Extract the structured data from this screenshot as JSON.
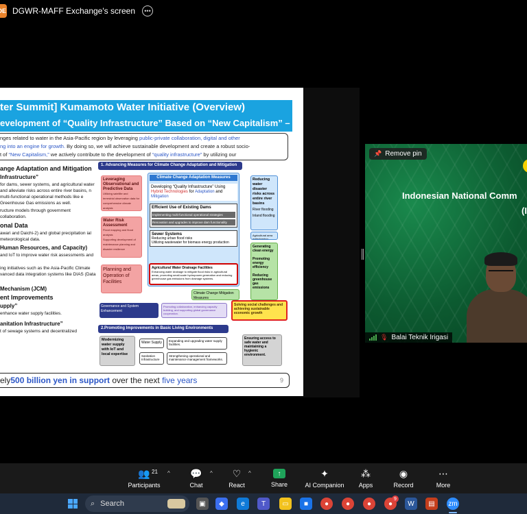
{
  "window": {
    "share_title": "DGWR-MAFF Exchange's screen",
    "badge": "DE"
  },
  "slide": {
    "title_line1": "ter Summit]   Kumamoto Water Initiative (Overview)",
    "title_line2": "evelopment of “Quality Infrastructure” Based on “New Capitalism” –",
    "intro_1": "nges related to water in the Asia-Pacific region by leveraging ",
    "intro_1_blue": "public-private collaboration, digital and other",
    "intro_2_blue": "ng into an engine for growth.",
    "intro_2": " By doing so, we will achieve sustainable development and create a robust socio-",
    "intro_3": "t of ",
    "intro_3_blue": "“New Capitalism,”",
    "intro_3b": " we actively contribute to the development of ",
    "intro_3_blue2": "“quality infrastructure”",
    "intro_3c": " by utilizing our",
    "left": {
      "h1": "ange Adaptation and Mitigation",
      "h2": "Infrastructure”",
      "p1": "for dams, sewer systems, and agricultural water and alleviate risks across entire river basins, n multi-functional operational methods like e Greenhouse Gas emissions as well.",
      "p2": "ructure models through government collaboration.",
      "h3": "onal Data",
      "p3": "awari and Daichi-2) and global precipitation ial meteorological data.",
      "h4": "Human Resources, and Capacity)",
      "p4": "and IoT to improve water risk assessments and",
      "p5": "ing initiatives such as the Asia-Pacific Climate vanced data integration systems like DIAS (Data",
      "h5": "Mechanism (JCM)",
      "h6": "ent Improvements",
      "h7": "upply”",
      "p6": "enhance water supply facilities.",
      "h8": "anitation Infrastructure”",
      "p7": "t of sewage systems and decentralized"
    },
    "diagram": {
      "band1": "1.   Advancing Measures for Climate Change Adaptation and Mitigation",
      "leveraging": "Leveraging Observational and Predictive Data",
      "leveraging_sub": "Utilizing satellite and terrestrial observation data for comprehensive climate analysis",
      "water_risk": "Water Risk Assessment",
      "water_risk_sub1": "Flood mapping and flood analysis",
      "water_risk_sub2": "Supporting development of maintenance planning and disaster resilience",
      "planning": "Planning and Operation of Facilities",
      "adapt_title": "Climate Change Adaptation Measures",
      "developing": "Developing “Quality Infrastructure” Using ",
      "developing_blue": "Hybrid Technologies",
      "developing_2": " for ",
      "developing_blue2": "Adaptation",
      "developing_3": " and ",
      "developing_blue3": "Mitigation",
      "dams_title": "Efficient Use of Existing Dams",
      "dams_1": "Implementing multi-functional operational strategies",
      "dams_2": "Renovation and upgrades to improve dam functionality",
      "sewer_title": "Sewer Systems",
      "sewer_1": "Reducing urban flood risks",
      "sewer_2": "Utilizing wastewater for biomass energy production",
      "agri_title": "Agricultural Water Drainage Facilities",
      "agri_sub": "Enhancing water drainage to mitigate flood risks in agricultural areas, promoting small-scale hydropower generation and reducing greenhouse gas emissions from drainage systems.",
      "mitig": "Climate Change Mitigation Measures",
      "reducing": "Reducing water disaster risks across entire river basins",
      "river_flooding": "River flooding",
      "inland_flooding": "Inland flooding",
      "agri_water": "Agricultural area waterlogging",
      "generating": "Generating clean energy",
      "promoting": "Promoting energy efficiency",
      "reducing_ghg": "Reducing greenhouse gas emissions",
      "governance": "Governance and System Enhancement",
      "governance_sub": "Promoting collaboration, enhancing capacity building, and supporting global governance cooperation.",
      "solving": "Solving social challenges and achieving sustainable economic growth",
      "band2": "2.Promoting Improvements in Basic Living Environments",
      "modernizing": "Modernizing water supply with IoT and local expertise",
      "water_supply": "Water Supply",
      "water_supply_sub": "Expanding and upgrading water supply facilities.",
      "sanitation": "Sanitation Infrastructure",
      "sanitation_sub": "Strengthening operational and maintenance management frameworks.",
      "ensuring": "Ensuring access to safe water and maintaining a hygienic environment."
    },
    "bottom_1": "ely ",
    "bottom_blue": "500 billion yen in support",
    "bottom_2": " over the next ",
    "bottom_blue2": "five years",
    "page_number": "9"
  },
  "video": {
    "remove_pin": "Remove pin",
    "title_line1": "Indonesian National Comm",
    "title_line2": "(I",
    "participant_name": "Balai Teknik Irigasi"
  },
  "toolbar": {
    "participants": "Participants",
    "participants_count": "21",
    "chat": "Chat",
    "react": "React",
    "share": "Share",
    "ai": "AI Companion",
    "apps": "Apps",
    "record": "Record",
    "more": "More"
  },
  "taskbar": {
    "search": "Search",
    "badge": "9"
  },
  "colors": {
    "accent_blue": "#1aa3e0",
    "share_green": "#1fa35a",
    "video_green": "#0e6b3a"
  }
}
